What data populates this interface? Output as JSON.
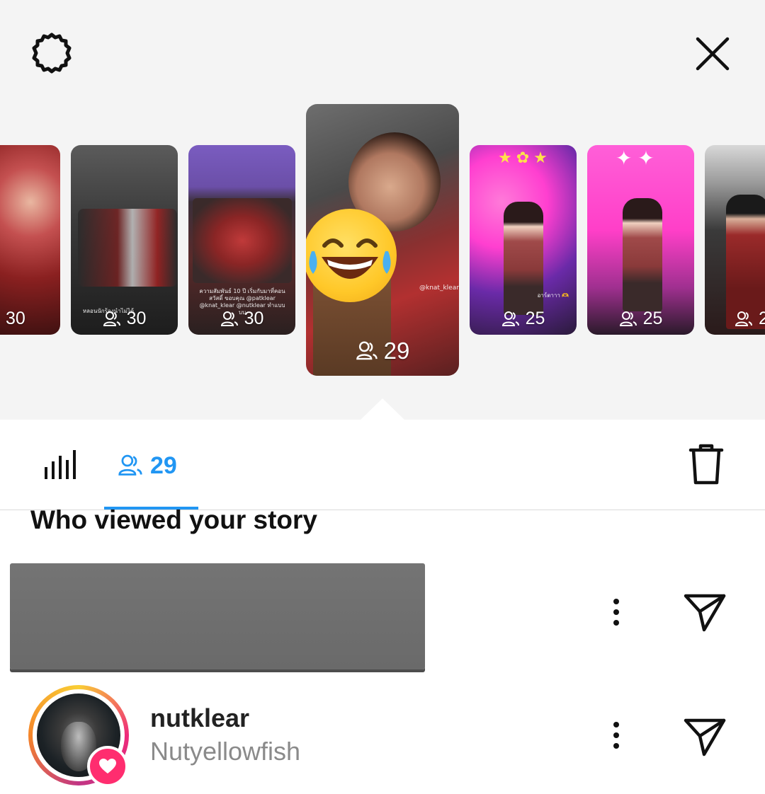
{
  "header": {
    "settings_icon": "gear-icon",
    "close_icon": "close-icon"
  },
  "stories": [
    {
      "count": "30",
      "bg": "#b03a3a"
    },
    {
      "count": "30",
      "bg": "#4a4a4a",
      "caption": "หลอนนักร้องนำไม่ได้"
    },
    {
      "count": "30",
      "bg": "#6b4fa8",
      "caption": "ความสัมพันธ์ 10 ปี เริ่มกับมาที่คอนสวัสดิ์ ขอบคุณ @patklear @knat_klear @nutklear ทำแบบบบ"
    },
    {
      "count": "29",
      "bg": "#6b2a2a",
      "mention": "@knat_klear"
    },
    {
      "count": "25",
      "bg": "#ff3fd0",
      "caption": "อาร์ตาาา 🫶"
    },
    {
      "count": "25",
      "bg": "#ff4fcf"
    },
    {
      "count": "2",
      "bg": "#2a2a2a"
    }
  ],
  "tabs": {
    "insights_icon": "bar-chart-icon",
    "viewers_icon": "viewers-icon",
    "viewers_count": "29",
    "delete_icon": "trash-icon",
    "accent": "#2196f3"
  },
  "section_title": "Who viewed your story",
  "viewers": [
    {
      "redacted": true
    },
    {
      "username": "nutklear",
      "full_name": "Nutyellowfish",
      "liked": true
    }
  ]
}
